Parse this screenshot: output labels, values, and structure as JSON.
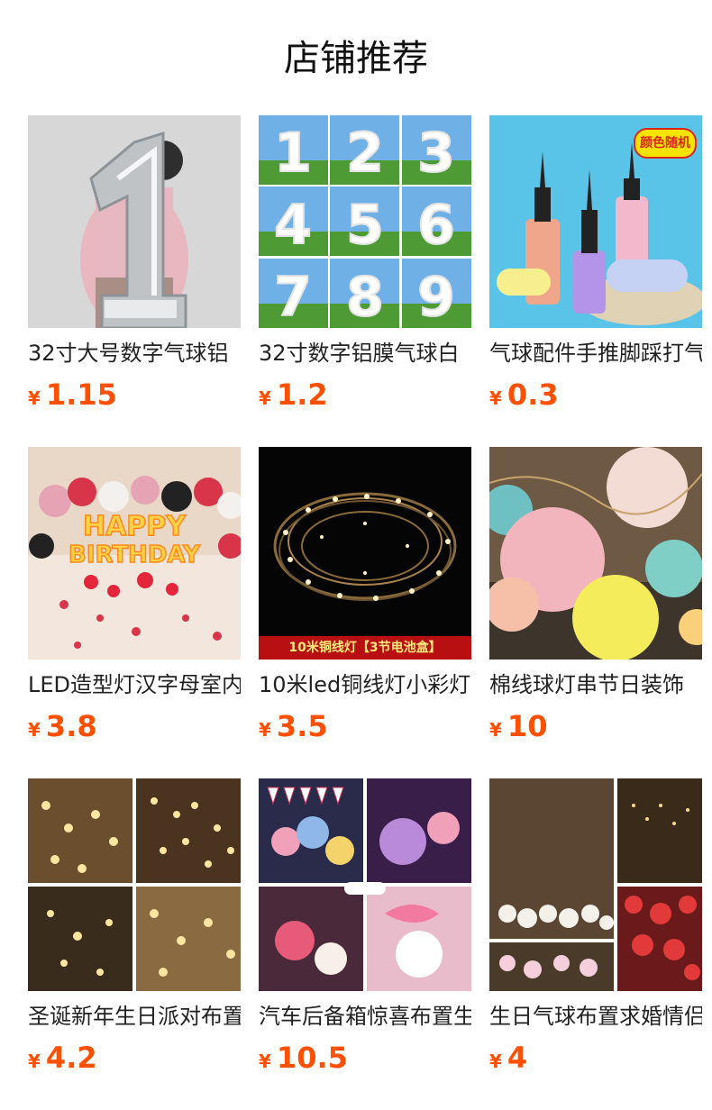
{
  "header": {
    "title": "店铺推荐"
  },
  "products": [
    {
      "name": "32寸大号数字气球铝",
      "currency": "¥",
      "price": "1.15",
      "image": "silver-number-1-balloon"
    },
    {
      "name": "32寸数字铝膜气球白",
      "currency": "¥",
      "price": "1.2",
      "image": "white-number-balloons-grid"
    },
    {
      "name": "气球配件手推脚踩打气",
      "currency": "¥",
      "price": "0.3",
      "image": "balloon-hand-pumps",
      "badge": "颜色随机"
    },
    {
      "name": "LED造型灯汉字母室内",
      "currency": "¥",
      "price": "3.8",
      "image": "happy-birthday-led-letters"
    },
    {
      "name": "10米led铜线灯小彩灯",
      "currency": "¥",
      "price": "3.5",
      "image": "copper-wire-string-lights",
      "banner": "10米铜线灯【3节电池盒】"
    },
    {
      "name": "棉线球灯串节日装饰",
      "currency": "¥",
      "price": "10",
      "image": "cotton-ball-lights"
    },
    {
      "name": "圣诞新年生日派对布置",
      "currency": "¥",
      "price": "4.2",
      "image": "star-fairy-lights-collage"
    },
    {
      "name": "汽车后备箱惊喜布置生",
      "currency": "¥",
      "price": "10.5",
      "image": "car-trunk-surprise-decor"
    },
    {
      "name": "生日气球布置求婚情侣",
      "currency": "¥",
      "price": "4",
      "image": "birthday-balloon-room-decor"
    }
  ],
  "colors": {
    "price": "#ff5000",
    "title": "#111111"
  }
}
